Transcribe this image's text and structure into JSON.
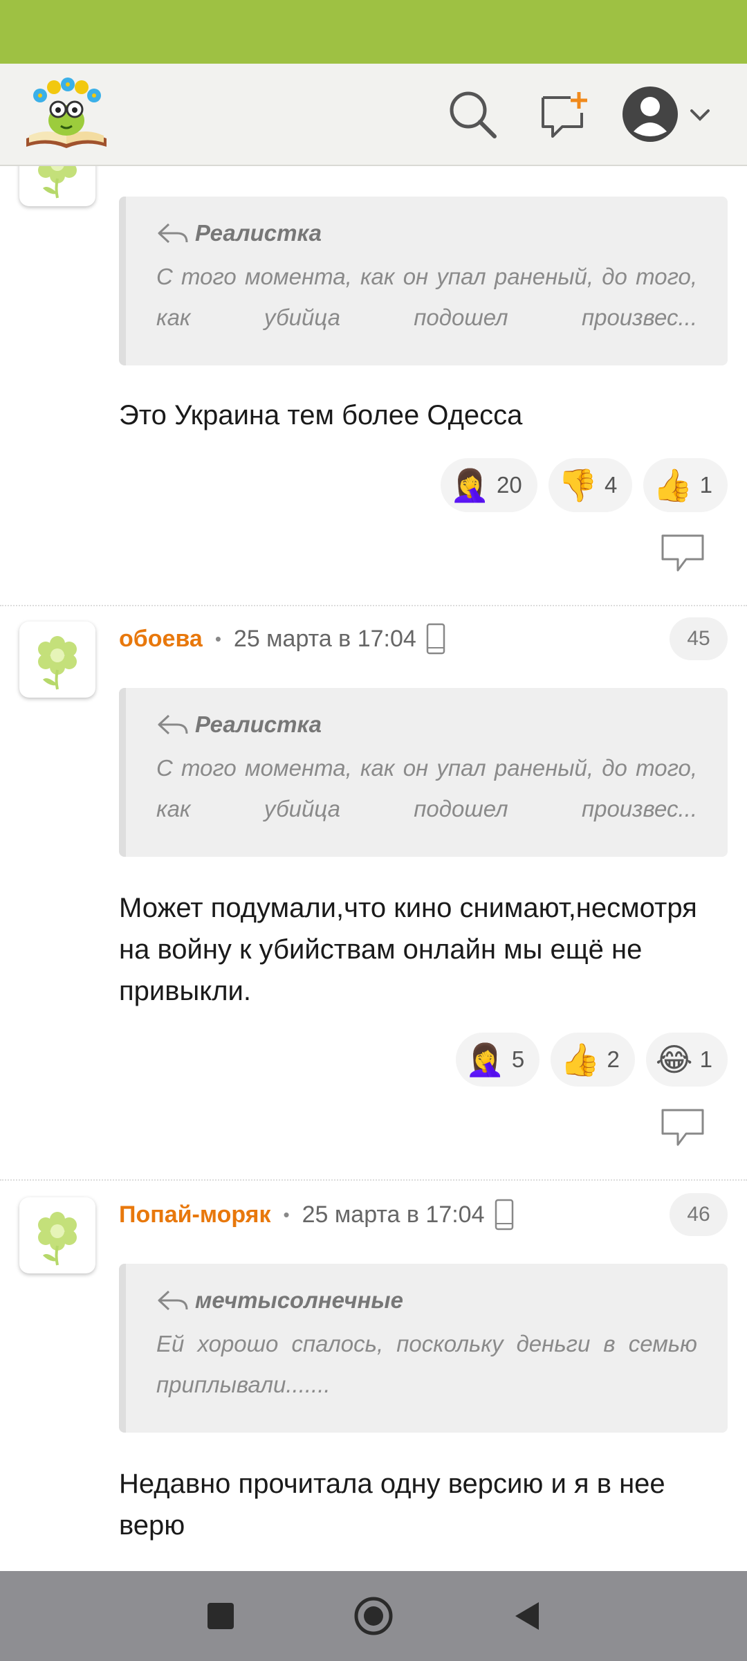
{
  "comments": [
    {
      "reply_to": "Реалистка",
      "quote": "С того момента, как он упал раненый, до того, как убийца подошел произвес...",
      "text": "Это Украина тем более Одесса",
      "reactions": [
        {
          "emoji": "🤦‍♀️",
          "count": "20"
        },
        {
          "emoji": "👎",
          "count": "4"
        },
        {
          "emoji": "👍",
          "count": "1"
        }
      ]
    },
    {
      "author": "обоева",
      "date": "25 марта в 17:04",
      "number": "45",
      "reply_to": "Реалистка",
      "quote": "С того момента, как он упал раненый, до того, как убийца подошел произвес...",
      "text": "Может подумали,что кино снимают,несмотря на войну к убийствам онлайн мы ещё не привыкли.",
      "reactions": [
        {
          "emoji": "🤦‍♀️",
          "count": "5"
        },
        {
          "emoji": "👍",
          "count": "2"
        },
        {
          "emoji": "😂",
          "count": "1"
        }
      ]
    },
    {
      "author": "Попай-моряк",
      "date": "25 марта в 17:04",
      "number": "46",
      "reply_to": "мечтысолнечные",
      "quote": "Ей хорошо спалось, поскольку деньги в семью приплывали.......",
      "text": "Недавно прочитала одну версию и я в нее верю"
    }
  ],
  "colors": {
    "status_bar": "#9ec143",
    "author": "#e8780c",
    "nav_bar": "#8e8e92"
  }
}
